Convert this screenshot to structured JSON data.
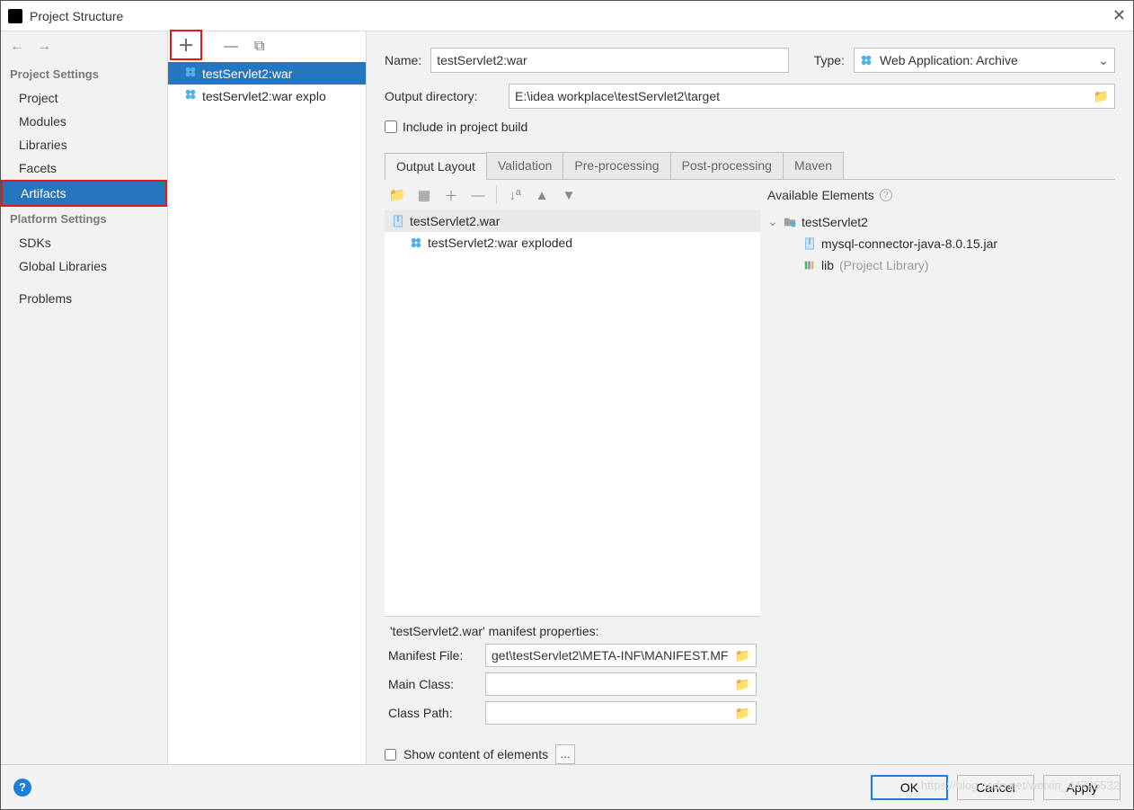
{
  "window": {
    "title": "Project Structure"
  },
  "sidebar": {
    "section1_label": "Project Settings",
    "section2_label": "Platform Settings",
    "items1": [
      "Project",
      "Modules",
      "Libraries",
      "Facets",
      "Artifacts"
    ],
    "items2": [
      "SDKs",
      "Global Libraries"
    ],
    "problems_label": "Problems",
    "selected": "Artifacts"
  },
  "artifacts_list": {
    "items": [
      {
        "label": "testServlet2:war",
        "selected": true
      },
      {
        "label": "testServlet2:war explo",
        "selected": false
      }
    ]
  },
  "form": {
    "name_label": "Name:",
    "name_value": "testServlet2:war",
    "type_label": "Type:",
    "type_value": "Web Application: Archive",
    "outdir_label": "Output directory:",
    "outdir_value": "E:\\idea workplace\\testServlet2\\target",
    "include_label": "Include in project build"
  },
  "tabs": [
    "Output Layout",
    "Validation",
    "Pre-processing",
    "Post-processing",
    "Maven"
  ],
  "layout": {
    "root_label": "testServlet2.war",
    "child_label": "testServlet2:war exploded",
    "available_label": "Available Elements",
    "available_tree": {
      "root": "testServlet2",
      "children": [
        {
          "label": "mysql-connector-java-8.0.15.jar",
          "icon": "archive"
        },
        {
          "label": "lib",
          "suffix": "(Project Library)",
          "icon": "lib"
        }
      ]
    }
  },
  "manifest": {
    "header": "'testServlet2.war' manifest properties:",
    "file_label": "Manifest File:",
    "file_value": "get\\testServlet2\\META-INF\\MANIFEST.MF",
    "mainclass_label": "Main Class:",
    "mainclass_value": "",
    "classpath_label": "Class Path:",
    "classpath_value": ""
  },
  "show_content_label": "Show content of elements",
  "footer": {
    "ok": "OK",
    "cancel": "Cancel",
    "apply": "Apply"
  },
  "watermark": "https://blog.csdn.net/weixin_44725532"
}
